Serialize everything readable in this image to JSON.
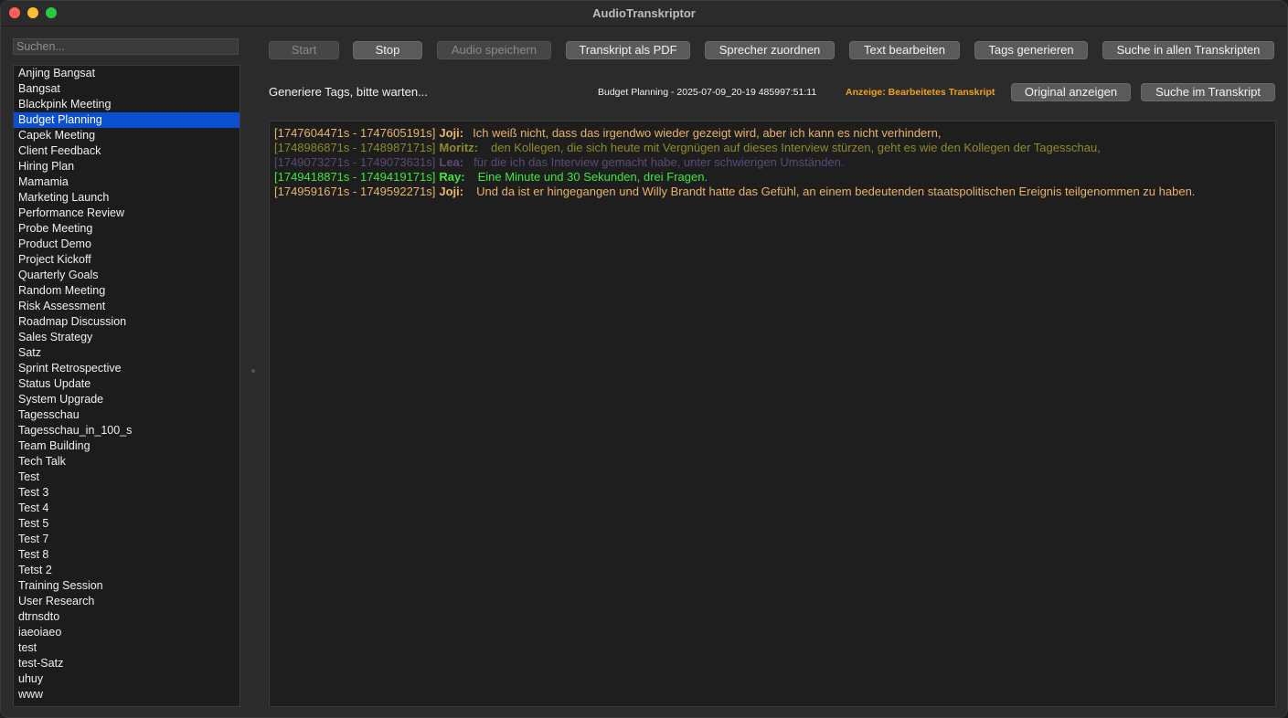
{
  "window": {
    "title": "AudioTranskriptor"
  },
  "sidebar": {
    "search_placeholder": "Suchen...",
    "items": [
      "Anjing Bangsat",
      "Bangsat",
      "Blackpink Meeting",
      "Budget Planning",
      "Capek Meeting",
      "Client Feedback",
      "Hiring Plan",
      "Mamamia",
      "Marketing Launch",
      "Performance Review",
      "Probe Meeting",
      "Product Demo",
      "Project Kickoff",
      "Quarterly Goals",
      "Random Meeting",
      "Risk Assessment",
      "Roadmap Discussion",
      "Sales Strategy",
      "Satz",
      "Sprint Retrospective",
      "Status Update",
      "System Upgrade",
      "Tagesschau",
      "Tagesschau_in_100_s",
      "Team Building",
      "Tech Talk",
      "Test",
      "Test 3",
      "Test 4",
      "Test 5",
      "Test 7",
      "Test 8",
      "Tetst 2",
      "Training Session",
      "User Research",
      "dtrnsdto",
      "iaeoiaeo",
      "test",
      "test-Satz",
      "uhuy",
      "www"
    ],
    "selected_index": 3
  },
  "toolbar": {
    "start": "Start",
    "stop": "Stop",
    "save_audio": "Audio speichern",
    "pdf": "Transkript als PDF",
    "assign_speaker": "Sprecher zuordnen",
    "edit_text": "Text bearbeiten",
    "generate_tags": "Tags generieren",
    "search_all": "Suche in allen Transkripten"
  },
  "status": {
    "message": "Generiere Tags, bitte warten...",
    "info": "Budget Planning - 2025-07-09_20-19   485997:51:11",
    "mode": "Anzeige: Bearbeitetes Transkript",
    "show_original": "Original anzeigen",
    "search_transcript": "Suche im Transkript"
  },
  "transcript": {
    "lines": [
      {
        "ts": "[1747604471s - 1747605191s]",
        "speaker": "Joji:",
        "text": "Ich weiß nicht, dass das irgendwo wieder gezeigt wird, aber ich kann es nicht verhindern,",
        "color": "#e8b36a"
      },
      {
        "ts": "[1748986871s - 1748987171s]",
        "speaker": "Moritz:",
        "text": "den Kollegen, die sich heute mit Vergnügen auf dieses Interview stürzen, geht es wie den Kollegen der Tagesschau,",
        "color": "#8c8c2a"
      },
      {
        "ts": "[1749073271s - 1749073631s]",
        "speaker": "Lea:",
        "text": "für die ich das Interview gemacht habe, unter schwierigen Umständen.",
        "color": "#5a4a78"
      },
      {
        "ts": "[1749418871s - 1749419171s]",
        "speaker": "Ray:",
        "text": "Eine Minute und 30 Sekunden, drei Fragen.",
        "color": "#3ee83e"
      },
      {
        "ts": "[1749591671s - 1749592271s]",
        "speaker": "Joji:",
        "text": "Und da ist er hingegangen und Willy Brandt hatte das Gefühl, an einem bedeutenden staatspolitischen Ereignis teilgenommen zu haben.",
        "color": "#e8b36a"
      }
    ]
  }
}
